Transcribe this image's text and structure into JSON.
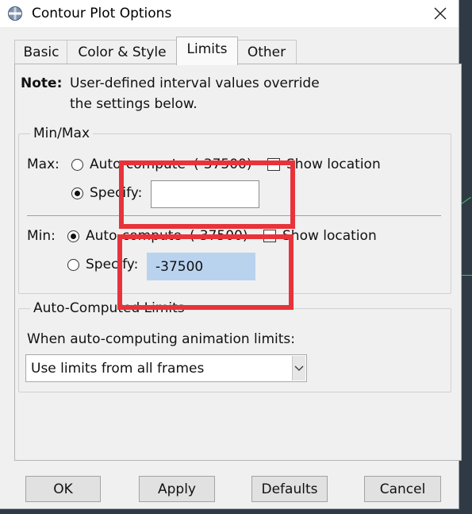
{
  "window": {
    "title": "Contour Plot Options"
  },
  "tabs": [
    {
      "label": "Basic"
    },
    {
      "label": "Color & Style"
    },
    {
      "label": "Limits"
    },
    {
      "label": "Other"
    }
  ],
  "active_tab": "Limits",
  "note": {
    "label": "Note:",
    "line1": "User-defined interval values override",
    "line2": "the settings below."
  },
  "minmax": {
    "title": "Min/Max",
    "max": {
      "label": "Max:",
      "auto_label": "Auto-compute",
      "auto_value": "(-37500)",
      "auto_selected": false,
      "show_location_label": "Show location",
      "show_location_checked": false,
      "specify_label": "Specify:",
      "specify_selected": true,
      "specify_value": ""
    },
    "min": {
      "label": "Min:",
      "auto_label": "Auto-compute",
      "auto_value": "(-37500)",
      "auto_selected": true,
      "show_location_label": "Show location",
      "show_location_checked": false,
      "specify_label": "Specify:",
      "specify_selected": false,
      "specify_value": "-37500"
    }
  },
  "auto_limits": {
    "title": "Auto-Computed Limits",
    "prompt": "When auto-computing animation limits:",
    "selected": "Use limits from all frames"
  },
  "buttons": {
    "ok": "OK",
    "apply": "Apply",
    "defaults": "Defaults",
    "cancel": "Cancel"
  },
  "colors": {
    "annotation": "#e8333a",
    "selection": "#b9d3ef"
  }
}
